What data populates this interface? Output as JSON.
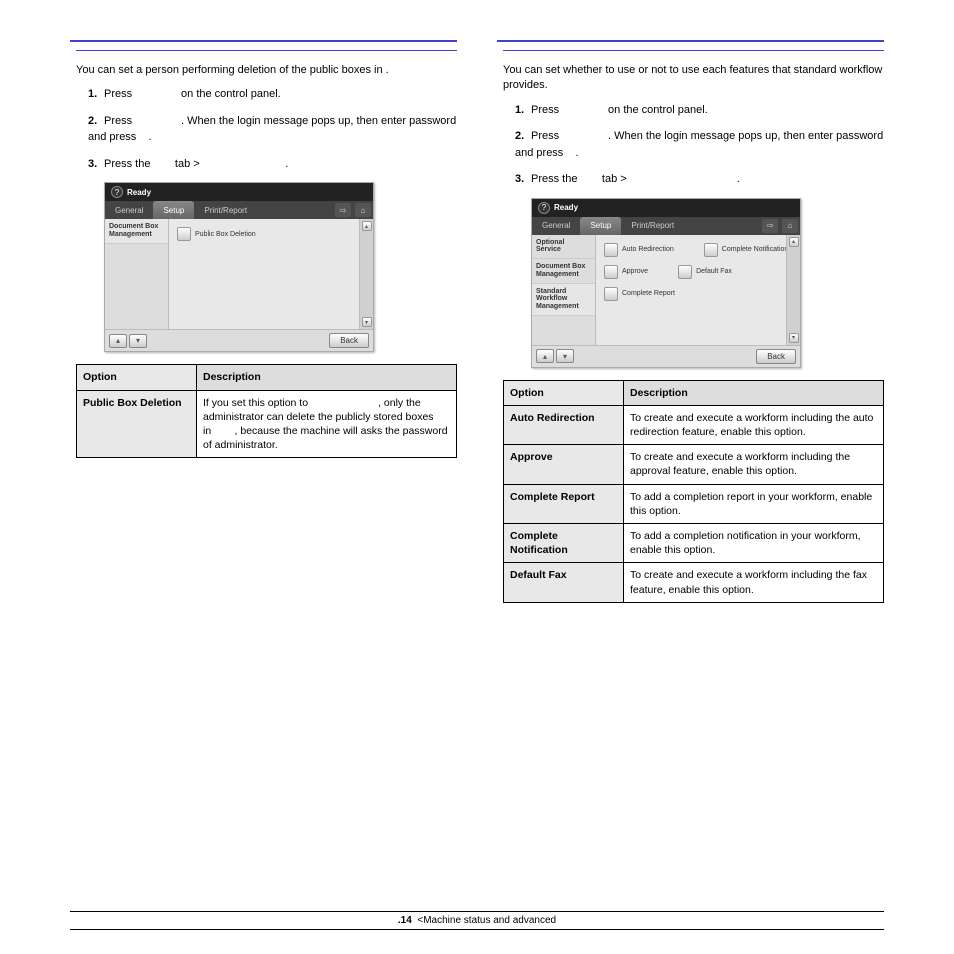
{
  "left": {
    "intro_a": "You can set a person performing deletion of the public boxes in",
    "intro_b": ".",
    "s1_a": "Press",
    "s1_b": "on the control panel.",
    "s2_a": "Press",
    "s2_b": ". When the login message pops up, then enter password and press",
    "s2_c": ".",
    "s3_a": "Press the",
    "s3_b": "tab >",
    "s3_c": ".",
    "device": {
      "ready": "Ready",
      "tabs": {
        "general": "General",
        "setup": "Setup",
        "print_report": "Print/Report"
      },
      "side": {
        "doc_box": "Document Box Management"
      },
      "options": {
        "public_box": "Public Box Deletion"
      },
      "back": "Back"
    },
    "table": {
      "h_option": "Option",
      "h_desc": "Description",
      "r1_opt": "Public Box Deletion",
      "r1_a": "If you set this option to",
      "r1_b": ", only the administrator can delete the publicly stored boxes in",
      "r1_c": ", because the machine will asks the password of administrator."
    }
  },
  "right": {
    "intro_a": "You can set whether to use or not to use each features that standard workflow provides.",
    "s1_a": "Press",
    "s1_b": "on the control panel.",
    "s2_a": "Press",
    "s2_b": ". When the login message pops up, then enter password and press",
    "s2_c": ".",
    "s3_a": "Press the",
    "s3_b": "tab >",
    "s3_c": ".",
    "device": {
      "ready": "Ready",
      "tabs": {
        "general": "General",
        "setup": "Setup",
        "print_report": "Print/Report"
      },
      "side": {
        "optional": "Optional Service",
        "doc_box": "Document Box Management",
        "workflow": "Standard Workflow Management"
      },
      "options": {
        "auto_redirect": "Auto Redirection",
        "complete_notif": "Complete Notification",
        "approve": "Approve",
        "default_fax": "Default Fax",
        "complete_report": "Complete Report"
      },
      "back": "Back"
    },
    "table": {
      "h_option": "Option",
      "h_desc": "Description",
      "rows": [
        {
          "opt": "Auto Redirection",
          "desc": "To create and execute a workform including the auto redirection feature, enable this option."
        },
        {
          "opt": "Approve",
          "desc": "To create and execute a workform including the approval feature, enable this option."
        },
        {
          "opt": "Complete Report",
          "desc": "To add a completion report in your workform, enable this option."
        },
        {
          "opt": "Complete Notification",
          "desc": "To add a completion notification in your workform, enable this option."
        },
        {
          "opt": "Default Fax",
          "desc": "To create and execute a workform including the fax feature, enable this option."
        }
      ]
    }
  },
  "footer": {
    "page": ".14",
    "text": "<Machine status and advanced"
  }
}
